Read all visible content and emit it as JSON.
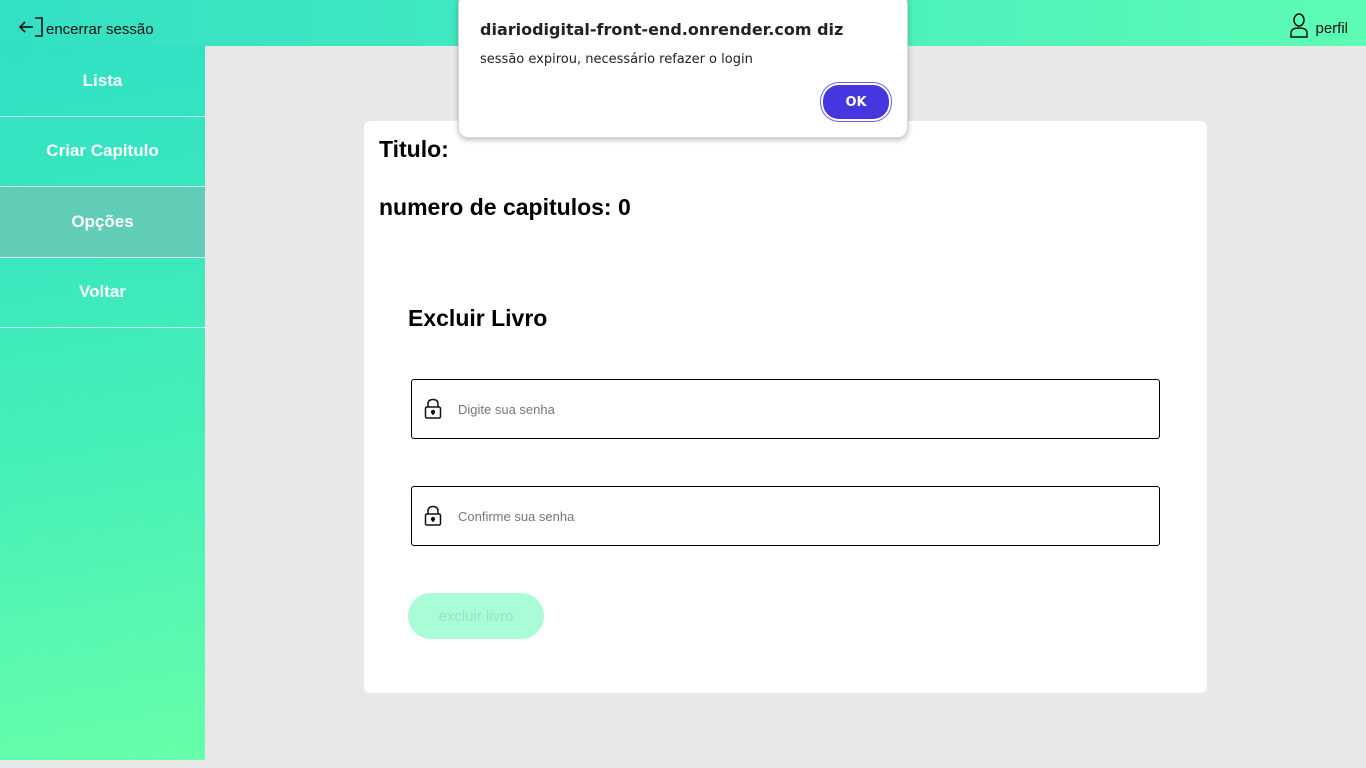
{
  "header": {
    "logout_label": "encerrar sessão",
    "profile_label": "perfil"
  },
  "sidebar": {
    "items": [
      {
        "label": "Lista"
      },
      {
        "label": "Criar Capitulo"
      },
      {
        "label": "Opções"
      },
      {
        "label": "Voltar"
      }
    ],
    "active_index": 2
  },
  "main": {
    "title_label": "Titulo:",
    "chapters_label": "numero de capitulos: 0",
    "section_title": "Excluir Livro",
    "password_placeholder": "Digite sua senha",
    "confirm_placeholder": "Confirme sua senha",
    "delete_button": "excluir livro"
  },
  "dialog": {
    "title": "diariodigital-front-end.onrender.com diz",
    "message": "sessão expirou, necessário refazer o login",
    "ok_label": "OK"
  },
  "colors": {
    "accent": "#45ecbf",
    "dialog_button": "#4536e0"
  }
}
